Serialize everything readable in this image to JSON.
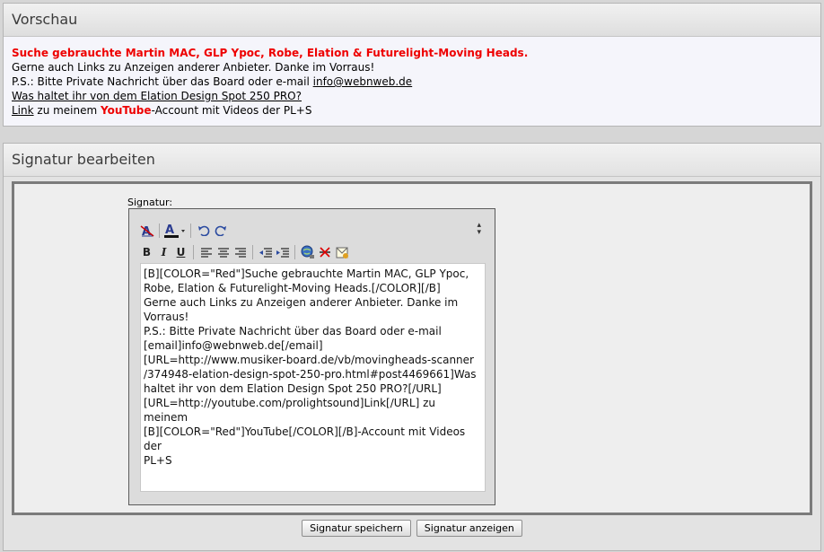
{
  "preview": {
    "title": "Vorschau",
    "line1_red": "Suche gebrauchte Martin MAC, GLP Ypoc, Robe, Elation & Futurelight-Moving Heads.",
    "line2": "Gerne auch Links zu Anzeigen anderer Anbieter. Danke im Vorraus!",
    "line3_prefix": "P.S.: Bitte Private Nachricht über das Board oder e-mail ",
    "line3_email": "info@webnweb.de",
    "line4_link": "Was haltet ihr von dem Elation Design Spot 250 PRO?",
    "line5_link": "Link",
    "line5_mid": " zu meinem ",
    "line5_red": "YouTube",
    "line5_suffix": "-Account mit Videos der PL+S"
  },
  "edit": {
    "title": "Signatur bearbeiten",
    "label": "Signatur:",
    "content": "[B][COLOR=\"Red\"]Suche gebrauchte Martin MAC, GLP Ypoc,\nRobe, Elation & Futurelight-Moving Heads.[/COLOR][/B]\nGerne auch Links zu Anzeigen anderer Anbieter. Danke im\nVorraus!\nP.S.: Bitte Private Nachricht über das Board oder e-mail\n[email]info@webnweb.de[/email]\n[URL=http://www.musiker-board.de/vb/movingheads-scanner\n/374948-elation-design-spot-250-pro.html#post4469661]Was\nhaltet ihr von dem Elation Design Spot 250 PRO?[/URL]\n[URL=http://youtube.com/prolightsound]Link[/URL] zu meinem\n[B][COLOR=\"Red\"]YouTube[/COLOR][/B]-Account mit Videos der\nPL+S",
    "save_label": "Signatur speichern",
    "show_label": "Signatur anzeigen"
  },
  "toolbar": {
    "bold": "B",
    "italic": "I",
    "underline": "U",
    "font_color": "A",
    "icons": [
      "remove-format-icon",
      "font-color-icon",
      "undo-icon",
      "redo-icon",
      "bold-icon",
      "italic-icon",
      "underline-icon",
      "align-left-icon",
      "align-center-icon",
      "align-right-icon",
      "outdent-icon",
      "indent-icon",
      "insert-link-icon",
      "remove-link-icon",
      "insert-email-icon",
      "resize-icon"
    ]
  },
  "colors": {
    "accent_red": "#ee0000",
    "panel_bg": "#f5f5fb",
    "edit_frame": "#7b7b7b"
  }
}
